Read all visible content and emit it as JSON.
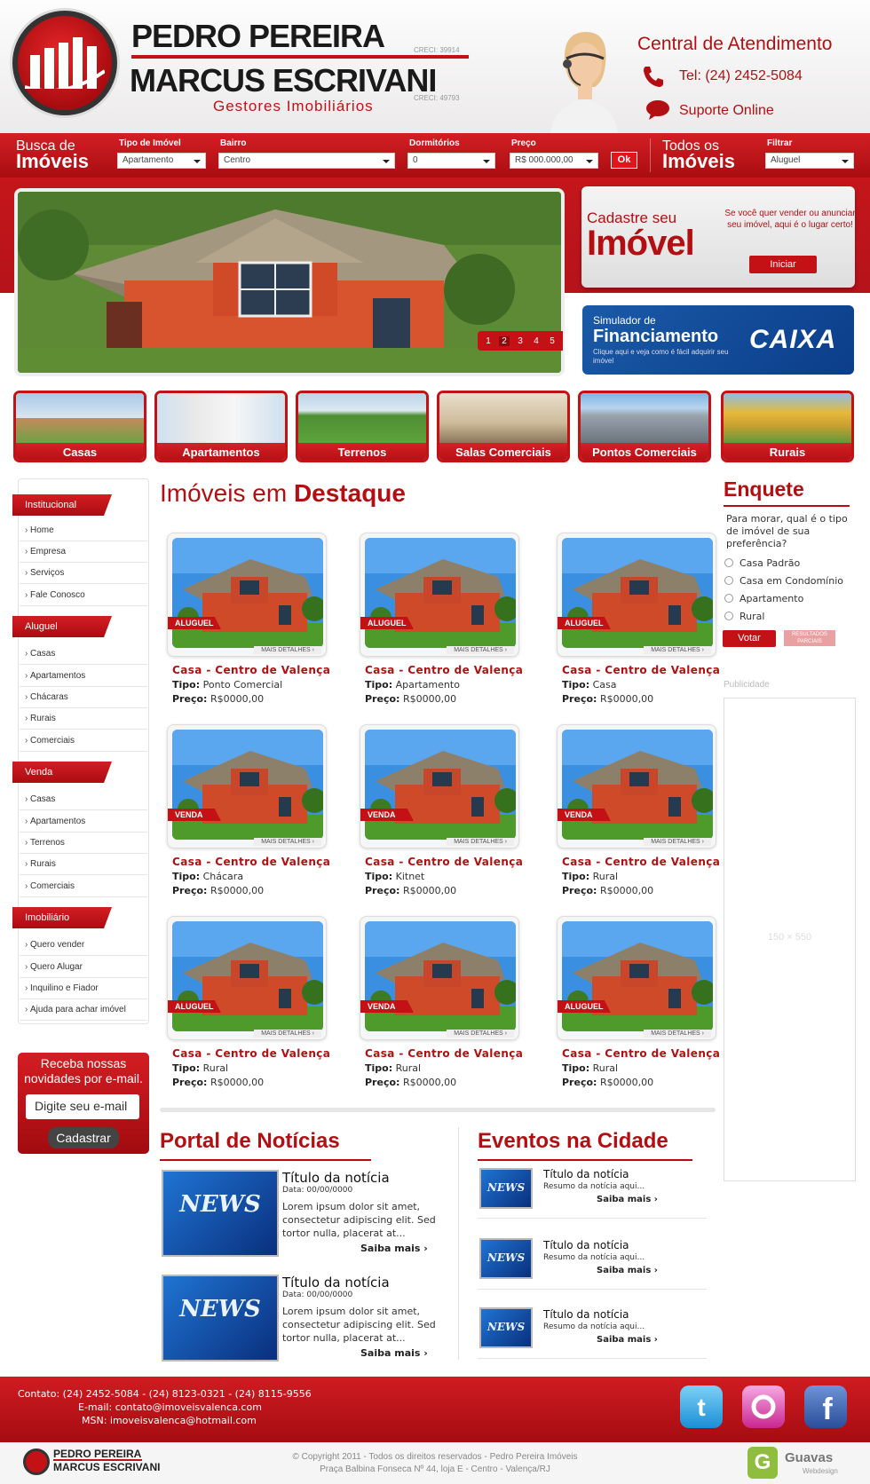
{
  "header": {
    "name1": "PEDRO PEREIRA",
    "name2": "MARCUS ESCRIVANI",
    "creci1": "CRECI: 39914",
    "creci2": "CRECI: 49793",
    "subtitle": "Gestores Imobiliários",
    "central_title": "Central de Atendimento",
    "phone": "Tel: (24) 2452-5084",
    "support": "Suporte Online",
    "icons": {
      "phone": "phone-icon",
      "chat": "chat-bubble-icon",
      "logo": "building-bars-logo"
    }
  },
  "search": {
    "label_top": "Busca de",
    "label_bottom": "Imóveis",
    "fields": [
      {
        "label": "Tipo de Imóvel",
        "value": "Apartamento"
      },
      {
        "label": "Bairro",
        "value": "Centro"
      },
      {
        "label": "Dormitórios",
        "value": "0"
      },
      {
        "label": "Preço",
        "value": "R$ 000.000,00"
      }
    ],
    "ok": "Ok",
    "all_top": "Todos os",
    "all_bottom": "Imóveis",
    "filter_label": "Filtrar",
    "filter_value": "Aluguel"
  },
  "slider": {
    "pages": [
      "1",
      "2",
      "3",
      "4",
      "5"
    ],
    "active": "2"
  },
  "cadastre": {
    "line1": "Cadastre seu",
    "line2": "Imóvel",
    "text": "Se você quer vender ou anunciar seu imóvel, aqui é o lugar certo!",
    "button": "Iniciar"
  },
  "simulator": {
    "line1": "Simulador de",
    "line2": "Financiamento",
    "text": "Clique aqui e veja como é fácil adquirir seu imóvel",
    "bank": "CAIXA"
  },
  "categories": [
    "Casas",
    "Apartamentos",
    "Terrenos",
    "Salas Comerciais",
    "Pontos Comerciais",
    "Rurais"
  ],
  "sidebar": {
    "groups": [
      {
        "title": "Institucional",
        "items": [
          "Home",
          "Empresa",
          "Serviços",
          "Fale Conosco"
        ]
      },
      {
        "title": "Aluguel",
        "items": [
          "Casas",
          "Apartamentos",
          "Chácaras",
          "Rurais",
          "Comerciais"
        ]
      },
      {
        "title": "Venda",
        "items": [
          "Casas",
          "Apartamentos",
          "Terrenos",
          "Rurais",
          "Comerciais"
        ]
      },
      {
        "title": "Imobiliário",
        "items": [
          "Quero vender",
          "Quero Alugar",
          "Inquilino e Fiador",
          "Ajuda para achar imóvel"
        ]
      }
    ],
    "newsletter": {
      "title": "Receba nossas novidades por e-mail.",
      "placeholder": "Digite seu e-mail",
      "button": "Cadastrar"
    }
  },
  "featured": {
    "title_a": "Imóveis em",
    "title_b": "Destaque",
    "more_label": "MAIS DETALHES ›",
    "type_label": "Tipo:",
    "price_label": "Preço:",
    "listings": [
      {
        "tag": "ALUGUEL",
        "title": "Casa - Centro de Valença",
        "type": "Ponto Comercial",
        "price": "R$0000,00"
      },
      {
        "tag": "ALUGUEL",
        "title": "Casa - Centro de Valença",
        "type": "Apartamento",
        "price": "R$0000,00"
      },
      {
        "tag": "ALUGUEL",
        "title": "Casa - Centro de Valença",
        "type": "Casa",
        "price": "R$0000,00"
      },
      {
        "tag": "VENDA",
        "title": "Casa - Centro de Valença",
        "type": "Chácara",
        "price": "R$0000,00"
      },
      {
        "tag": "VENDA",
        "title": "Casa - Centro de Valença",
        "type": "Kitnet",
        "price": "R$0000,00"
      },
      {
        "tag": "VENDA",
        "title": "Casa - Centro de Valença",
        "type": "Rural",
        "price": "R$0000,00"
      },
      {
        "tag": "ALUGUEL",
        "title": "Casa - Centro de Valença",
        "type": "Rural",
        "price": "R$0000,00"
      },
      {
        "tag": "VENDA",
        "title": "Casa - Centro de Valença",
        "type": "Rural",
        "price": "R$0000,00"
      },
      {
        "tag": "ALUGUEL",
        "title": "Casa - Centro de Valença",
        "type": "Rural",
        "price": "R$0000,00"
      }
    ]
  },
  "news": {
    "title": "Portal de Notícias",
    "thumb_text": "NEWS",
    "items": [
      {
        "title": "Título da notícia",
        "date": "Data: 00/00/0000",
        "text": "Lorem ipsum dolor sit amet, consectetur adipiscing elit. Sed tortor nulla, placerat at...",
        "more": "Saiba mais ›"
      },
      {
        "title": "Título da notícia",
        "date": "Data: 00/00/0000",
        "text": "Lorem ipsum dolor sit amet, consectetur adipiscing elit. Sed tortor nulla, placerat at...",
        "more": "Saiba mais ›"
      }
    ]
  },
  "events": {
    "title": "Eventos na Cidade",
    "items": [
      {
        "title": "Título da notícia",
        "text": "Resumo da notícia aqui...",
        "more": "Saiba mais ›"
      },
      {
        "title": "Título da notícia",
        "text": "Resumo da notícia aqui...",
        "more": "Saiba mais ›"
      },
      {
        "title": "Título da notícia",
        "text": "Resumo da notícia aqui...",
        "more": "Saiba mais ›"
      }
    ]
  },
  "poll": {
    "title": "Enquete",
    "question": "Para morar, qual é o tipo de imóvel de sua preferência?",
    "options": [
      "Casa Padrão",
      "Casa em Condomínio",
      "Apartamento",
      "Rural"
    ],
    "vote": "Votar",
    "results": "RESULTADOS PARCIAIS"
  },
  "ad": {
    "label": "Publicidade",
    "size": "150 × 550"
  },
  "footer": {
    "contact": "Contato: (24) 2452-5084 - (24) 8123-0321 - (24) 8115-9556",
    "email": "E-mail: contato@imoveisvalenca.com",
    "msn": "MSN: imoveisvalenca@hotmail.com",
    "name1": "PEDRO PEREIRA",
    "name2": "MARCUS ESCRIVANI",
    "copyright": "© Copyright 2011 - Todos os direitos reservados - Pedro Pereira Imóveis",
    "address": "Praça Balbina Fonseca Nº 44, loja E - Centro -  Valença/RJ",
    "credit": "Guavas",
    "credit_sub": "Webdesign",
    "credit_icon": "G",
    "social": [
      "twitter-icon",
      "orkut-icon",
      "facebook-icon"
    ]
  }
}
